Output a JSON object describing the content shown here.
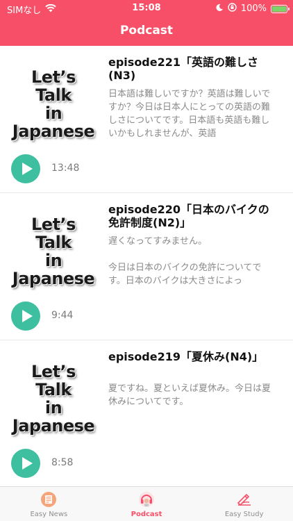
{
  "status_bar": {
    "carrier": "SIMなし",
    "time": "15:08",
    "battery": "100%",
    "battery_level": 1.0
  },
  "header": {
    "title": "Podcast"
  },
  "colors": {
    "accent": "#f64f67",
    "play": "#3dbfa0",
    "battery_fill": "#7cd36a"
  },
  "episodes": [
    {
      "thumb_lines": [
        "Let’s",
        "Talk",
        "in",
        "Japanese"
      ],
      "title": "episode221「英語の難しさ(N3)",
      "description": "日本語は難しいですか？英語は難しいですか？今日は日本人にとっての英語の難しさについてです。日本語も英語も難しいかもしれませんが、英語",
      "duration": "13:48"
    },
    {
      "thumb_lines": [
        "Let’s",
        "Talk",
        "in",
        "Japanese"
      ],
      "title": "episode220「日本のバイクの免許制度(N2)」",
      "description": "遅くなってすみません。\n\n今日は日本のバイクの免許についてです。日本のバイクは大きさによっ",
      "duration": "9:44"
    },
    {
      "thumb_lines": [
        "Let’s",
        "Talk",
        "in",
        "Japanese"
      ],
      "title": "episode219「夏休み(N4)」",
      "description": "夏ですね。夏といえば夏休み。今日は夏休みについてです。",
      "duration": "8:58"
    }
  ],
  "tabs": [
    {
      "label": "Easy News",
      "icon": "news-icon",
      "active": false
    },
    {
      "label": "Podcast",
      "icon": "podcast-icon",
      "active": true
    },
    {
      "label": "Easy Study",
      "icon": "study-icon",
      "active": false
    }
  ]
}
